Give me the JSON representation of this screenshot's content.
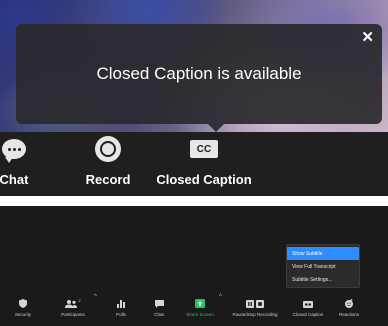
{
  "toast": {
    "message": "Closed Caption is available",
    "close_icon": "close-icon"
  },
  "top_toolbar": {
    "chat_label": "Chat",
    "record_label": "Record",
    "cc_label": "Closed Caption",
    "cc_icon_text": "CC"
  },
  "cc_menu": {
    "items": [
      {
        "label": "Show Subtitle",
        "active": true
      },
      {
        "label": "View Full Transcript",
        "active": false
      },
      {
        "label": "Subtitle Settings...",
        "active": false
      }
    ]
  },
  "bottom_toolbar": {
    "participants_count": "2",
    "items": [
      {
        "label": "Security",
        "icon": "shield-icon"
      },
      {
        "label": "Participants",
        "icon": "participants-icon"
      },
      {
        "label": "Polls",
        "icon": "polls-icon"
      },
      {
        "label": "Chat",
        "icon": "chat-icon"
      },
      {
        "label": "Share Screen",
        "icon": "share-screen-icon"
      },
      {
        "label": "Pause/Stop Recording",
        "icon": "pause-stop-icon"
      },
      {
        "label": "Closed Caption",
        "icon": "closed-caption-icon"
      },
      {
        "label": "Reactions",
        "icon": "reactions-icon"
      }
    ]
  },
  "colors": {
    "accent_blue": "#2d8cff",
    "share_green": "#22c55e",
    "toolbar_bg": "#1f1f1f"
  }
}
